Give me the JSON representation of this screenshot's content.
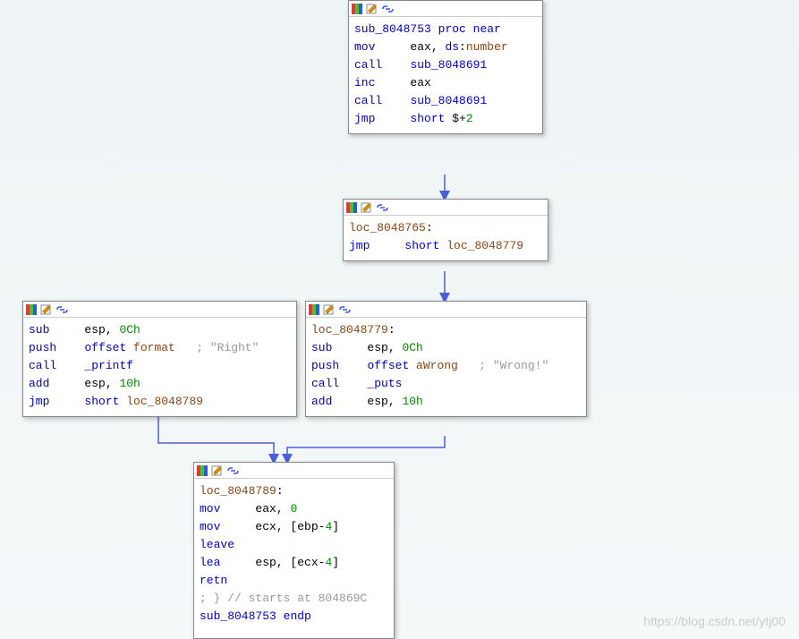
{
  "nodes": {
    "n1": {
      "lines": [
        {
          "segs": [
            {
              "t": "",
              "c": "txt"
            }
          ]
        },
        {
          "segs": [
            {
              "t": "sub_8048753",
              "c": "func"
            },
            {
              "t": " ",
              "c": "txt"
            },
            {
              "t": "proc near",
              "c": "kw"
            }
          ]
        },
        {
          "segs": [
            {
              "t": "mov",
              "c": "kw"
            },
            {
              "t": "     ",
              "c": "txt"
            },
            {
              "t": "eax",
              "c": "reg"
            },
            {
              "t": ", ",
              "c": "txt"
            },
            {
              "t": "ds",
              "c": "kw"
            },
            {
              "t": ":",
              "c": "txt"
            },
            {
              "t": "number",
              "c": "addr"
            }
          ]
        },
        {
          "segs": [
            {
              "t": "call",
              "c": "kw"
            },
            {
              "t": "    ",
              "c": "txt"
            },
            {
              "t": "sub_8048691",
              "c": "func"
            }
          ]
        },
        {
          "segs": [
            {
              "t": "inc",
              "c": "kw"
            },
            {
              "t": "     ",
              "c": "txt"
            },
            {
              "t": "eax",
              "c": "reg"
            }
          ]
        },
        {
          "segs": [
            {
              "t": "call",
              "c": "kw"
            },
            {
              "t": "    ",
              "c": "txt"
            },
            {
              "t": "sub_8048691",
              "c": "func"
            }
          ]
        },
        {
          "segs": [
            {
              "t": "jmp",
              "c": "kw"
            },
            {
              "t": "     ",
              "c": "txt"
            },
            {
              "t": "short ",
              "c": "kw"
            },
            {
              "t": "$",
              "c": "txt"
            },
            {
              "t": "+",
              "c": "txt"
            },
            {
              "t": "2",
              "c": "num"
            }
          ]
        }
      ]
    },
    "n2": {
      "lines": [
        {
          "segs": [
            {
              "t": "",
              "c": "txt"
            }
          ]
        },
        {
          "segs": [
            {
              "t": "loc_8048765",
              "c": "addr"
            },
            {
              "t": ":",
              "c": "txt"
            }
          ]
        },
        {
          "segs": [
            {
              "t": "jmp",
              "c": "kw"
            },
            {
              "t": "     ",
              "c": "txt"
            },
            {
              "t": "short ",
              "c": "kw"
            },
            {
              "t": "loc_8048779",
              "c": "addr"
            }
          ]
        }
      ]
    },
    "n3": {
      "lines": [
        {
          "segs": [
            {
              "t": "sub",
              "c": "kw"
            },
            {
              "t": "     ",
              "c": "txt"
            },
            {
              "t": "esp",
              "c": "reg"
            },
            {
              "t": ", ",
              "c": "txt"
            },
            {
              "t": "0Ch",
              "c": "num"
            }
          ]
        },
        {
          "segs": [
            {
              "t": "push",
              "c": "kw"
            },
            {
              "t": "    ",
              "c": "txt"
            },
            {
              "t": "offset ",
              "c": "kw"
            },
            {
              "t": "format",
              "c": "addr"
            },
            {
              "t": "   ",
              "c": "txt"
            },
            {
              "t": "; \"Right\"",
              "c": "cmt"
            }
          ]
        },
        {
          "segs": [
            {
              "t": "call",
              "c": "kw"
            },
            {
              "t": "    ",
              "c": "txt"
            },
            {
              "t": "_printf",
              "c": "func"
            }
          ]
        },
        {
          "segs": [
            {
              "t": "add",
              "c": "kw"
            },
            {
              "t": "     ",
              "c": "txt"
            },
            {
              "t": "esp",
              "c": "reg"
            },
            {
              "t": ", ",
              "c": "txt"
            },
            {
              "t": "10h",
              "c": "num"
            }
          ]
        },
        {
          "segs": [
            {
              "t": "jmp",
              "c": "kw"
            },
            {
              "t": "     ",
              "c": "txt"
            },
            {
              "t": "short ",
              "c": "kw"
            },
            {
              "t": "loc_8048789",
              "c": "addr"
            }
          ]
        }
      ]
    },
    "n4": {
      "lines": [
        {
          "segs": [
            {
              "t": "",
              "c": "txt"
            }
          ]
        },
        {
          "segs": [
            {
              "t": "loc_8048779",
              "c": "addr"
            },
            {
              "t": ":",
              "c": "txt"
            }
          ]
        },
        {
          "segs": [
            {
              "t": "sub",
              "c": "kw"
            },
            {
              "t": "     ",
              "c": "txt"
            },
            {
              "t": "esp",
              "c": "reg"
            },
            {
              "t": ", ",
              "c": "txt"
            },
            {
              "t": "0Ch",
              "c": "num"
            }
          ]
        },
        {
          "segs": [
            {
              "t": "push",
              "c": "kw"
            },
            {
              "t": "    ",
              "c": "txt"
            },
            {
              "t": "offset ",
              "c": "kw"
            },
            {
              "t": "aWrong",
              "c": "addr"
            },
            {
              "t": "   ",
              "c": "txt"
            },
            {
              "t": "; \"Wrong!\"",
              "c": "cmt"
            }
          ]
        },
        {
          "segs": [
            {
              "t": "call",
              "c": "kw"
            },
            {
              "t": "    ",
              "c": "txt"
            },
            {
              "t": "_puts",
              "c": "func"
            }
          ]
        },
        {
          "segs": [
            {
              "t": "add",
              "c": "kw"
            },
            {
              "t": "     ",
              "c": "txt"
            },
            {
              "t": "esp",
              "c": "reg"
            },
            {
              "t": ", ",
              "c": "txt"
            },
            {
              "t": "10h",
              "c": "num"
            }
          ]
        }
      ]
    },
    "n5": {
      "lines": [
        {
          "segs": [
            {
              "t": "",
              "c": "txt"
            }
          ]
        },
        {
          "segs": [
            {
              "t": "loc_8048789",
              "c": "addr"
            },
            {
              "t": ":",
              "c": "txt"
            }
          ]
        },
        {
          "segs": [
            {
              "t": "mov",
              "c": "kw"
            },
            {
              "t": "     ",
              "c": "txt"
            },
            {
              "t": "eax",
              "c": "reg"
            },
            {
              "t": ", ",
              "c": "txt"
            },
            {
              "t": "0",
              "c": "num"
            }
          ]
        },
        {
          "segs": [
            {
              "t": "mov",
              "c": "kw"
            },
            {
              "t": "     ",
              "c": "txt"
            },
            {
              "t": "ecx",
              "c": "reg"
            },
            {
              "t": ", [",
              "c": "txt"
            },
            {
              "t": "ebp",
              "c": "reg"
            },
            {
              "t": "-",
              "c": "txt"
            },
            {
              "t": "4",
              "c": "num"
            },
            {
              "t": "]",
              "c": "txt"
            }
          ]
        },
        {
          "segs": [
            {
              "t": "leave",
              "c": "kw"
            }
          ]
        },
        {
          "segs": [
            {
              "t": "lea",
              "c": "kw"
            },
            {
              "t": "     ",
              "c": "txt"
            },
            {
              "t": "esp",
              "c": "reg"
            },
            {
              "t": ", [",
              "c": "txt"
            },
            {
              "t": "ecx",
              "c": "reg"
            },
            {
              "t": "-",
              "c": "txt"
            },
            {
              "t": "4",
              "c": "num"
            },
            {
              "t": "]",
              "c": "txt"
            }
          ]
        },
        {
          "segs": [
            {
              "t": "retn",
              "c": "kw"
            }
          ]
        },
        {
          "segs": [
            {
              "t": "; } // starts at 804869C",
              "c": "cmt"
            }
          ]
        },
        {
          "segs": [
            {
              "t": "sub_8048753",
              "c": "func"
            },
            {
              "t": " ",
              "c": "txt"
            },
            {
              "t": "endp",
              "c": "kw"
            }
          ]
        }
      ]
    }
  },
  "watermark": "https://blog.csdn.net/ytj00"
}
